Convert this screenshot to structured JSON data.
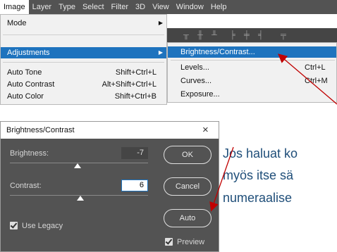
{
  "menubar": {
    "items": [
      "Image",
      "Layer",
      "Type",
      "Select",
      "Filter",
      "3D",
      "View",
      "Window",
      "Help"
    ],
    "active": "Image"
  },
  "image_menu": {
    "items": [
      {
        "label": "Mode",
        "shortcut": "",
        "submenu": true
      },
      {
        "label": "Adjustments",
        "shortcut": "",
        "submenu": true,
        "highlighted": true
      },
      {
        "label": "Auto Tone",
        "shortcut": "Shift+Ctrl+L"
      },
      {
        "label": "Auto Contrast",
        "shortcut": "Alt+Shift+Ctrl+L"
      },
      {
        "label": "Auto Color",
        "shortcut": "Shift+Ctrl+B"
      }
    ]
  },
  "adjustments_menu": {
    "items": [
      {
        "label": "Brightness/Contrast...",
        "shortcut": "",
        "highlighted": true
      },
      {
        "label": "Levels...",
        "shortcut": "Ctrl+L"
      },
      {
        "label": "Curves...",
        "shortcut": "Ctrl+M"
      },
      {
        "label": "Exposure...",
        "shortcut": ""
      }
    ]
  },
  "dialog": {
    "title": "Brightness/Contrast",
    "close": "×",
    "brightness": {
      "label": "Brightness:",
      "value": "-7",
      "slider_fraction": 0.49
    },
    "contrast": {
      "label": "Contrast:",
      "value": "6",
      "slider_fraction": 0.51
    },
    "use_legacy": {
      "label": "Use Legacy",
      "checked": true
    },
    "preview": {
      "label": "Preview",
      "checked": true
    },
    "buttons": {
      "ok": "OK",
      "cancel": "Cancel",
      "auto": "Auto"
    }
  },
  "annotation": {
    "lines": [
      "Jos haluat ko",
      "myös itse sä",
      "numeraalise"
    ],
    "arrow_color": "#c00000",
    "text_color": "#1f4e79"
  },
  "colors": {
    "menubar": "#535353",
    "highlight": "#1e73be",
    "dialog_bg": "#535353"
  }
}
